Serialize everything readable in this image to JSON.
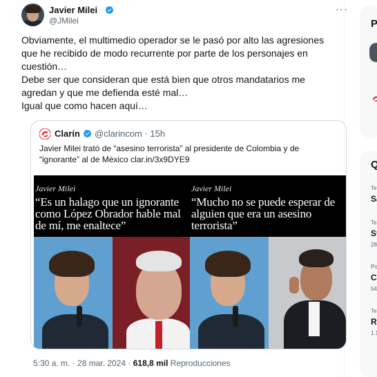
{
  "tweet": {
    "author_name": "Javier Milei",
    "author_handle": "@JMilei",
    "more_icon": "more-dots-icon",
    "verified_color": "#1d9bf0",
    "body_lines": [
      "Obviamente, el multimedio operador se le pasó por alto las agresiones",
      "que he recibido de modo recurrente por parte de los personajes en",
      "cuestión…",
      "Debe ser que consideran que está bien que otros mandatarios me",
      "agredan y que me defienda esté mal…",
      "Igual que como hacen aquí…"
    ],
    "timestamp": "5:30 a. m. · 28 mar. 2024 · ",
    "views_count": "618,8 mil",
    "views_label": " Reproducciones"
  },
  "quote": {
    "source_name": "Clarín",
    "source_handle": "@clarincom",
    "age": "15h",
    "brand_color": "#e5202e",
    "text_lines": [
      "Javier Milei trató de “asesino terrorista” al presidente de Colombia y de",
      "“ignorante” al de México clar.in/3x9DYE9"
    ],
    "panels": [
      {
        "author": "Javier Milei",
        "quote_lines": [
          "“Es un halago que un ignorante",
          "como López Obrador hable mal",
          "de mí, me enaltece”"
        ]
      },
      {
        "author": "Javier Milei",
        "quote_lines": [
          "“Mucho no se puede esperar de",
          "alguien que era un asesino",
          "terrorista”"
        ]
      }
    ]
  },
  "sidebar": {
    "card1_title": "P",
    "card2_title": "Q",
    "trends": [
      {
        "small": "Te",
        "big": "Sa"
      },
      {
        "small": "Te",
        "big": "St",
        "count": "28"
      },
      {
        "small": "Po",
        "big": "Ca",
        "count": "54"
      },
      {
        "small": "Te",
        "big": "Ru",
        "count": "1.1"
      }
    ]
  }
}
